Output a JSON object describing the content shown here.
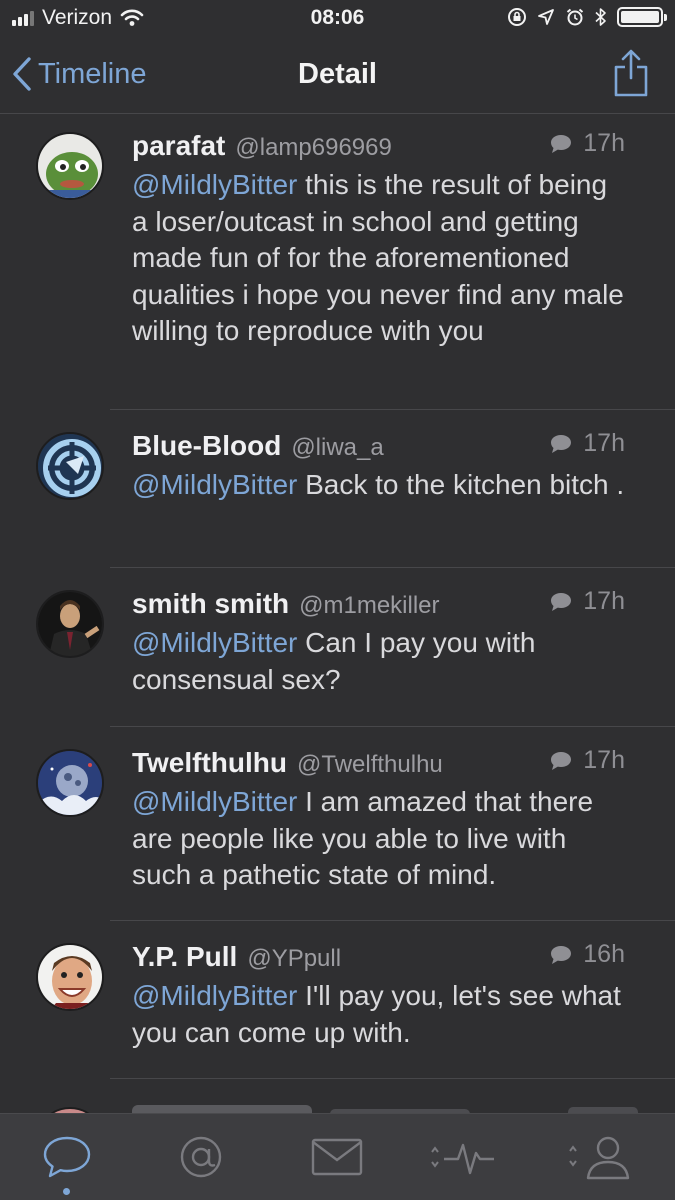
{
  "status_bar": {
    "carrier": "Verizon",
    "time": "08:06"
  },
  "nav": {
    "back_label": "Timeline",
    "title": "Detail"
  },
  "tweets": [
    {
      "name": "parafat",
      "handle": "@lamp696969",
      "time": "17h",
      "mention": "@MildlyBitter",
      "text": " this is the result of being a loser/outcast in school and getting made fun of for the aforementioned qualities i hope you never find any male willing to reproduce with you"
    },
    {
      "name": "Blue-Blood",
      "handle": "@liwa_a",
      "time": "17h",
      "mention": "@MildlyBitter",
      "text": " Back to the kitchen bitch ."
    },
    {
      "name": "smith smith",
      "handle": "@m1mekiller",
      "time": "17h",
      "mention": "@MildlyBitter",
      "text": " Can I pay you with consensual sex?"
    },
    {
      "name": "Twelfthulhu",
      "handle": "@Twelfthulhu",
      "time": "17h",
      "mention": "@MildlyBitter",
      "text": " I am amazed that there are people like you able to live with such a pathetic state of mind."
    },
    {
      "name": "Y.P. Pull",
      "handle": "@YPpull",
      "time": "16h",
      "mention": "@MildlyBitter",
      "text": " I'll pay you, let's see what you can come up with."
    }
  ],
  "tabbar": {
    "icons": [
      "speech-bubble-icon",
      "at-sign-icon",
      "envelope-icon",
      "activity-icon",
      "profile-icon"
    ],
    "active": "speech-bubble-icon"
  },
  "colors": {
    "background": "#2f2f31",
    "accent": "#7ea6d6",
    "text": "#d9d9dc",
    "muted": "#8f8f94"
  }
}
